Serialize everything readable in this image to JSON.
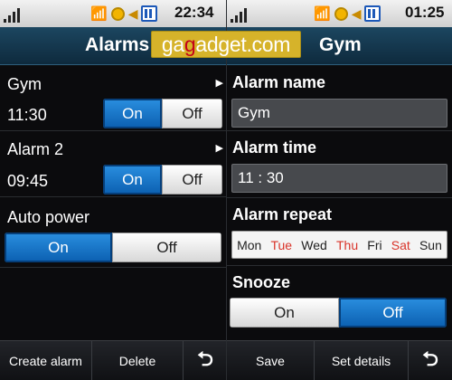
{
  "left": {
    "status": {
      "time": "22:34"
    },
    "title": "Alarms",
    "alarms": [
      {
        "name": "Gym",
        "time": "11:30",
        "on_label": "On",
        "off_label": "Off",
        "state": "on"
      },
      {
        "name": "Alarm 2",
        "time": "09:45",
        "on_label": "On",
        "off_label": "Off",
        "state": "on"
      }
    ],
    "auto_power": {
      "label": "Auto power",
      "on_label": "On",
      "off_label": "Off",
      "state": "on"
    },
    "softkeys": {
      "create": "Create alarm",
      "delete": "Delete"
    }
  },
  "right": {
    "status": {
      "time": "01:25"
    },
    "title": "Gym",
    "alarm_name": {
      "label": "Alarm name",
      "value": "Gym"
    },
    "alarm_time": {
      "label": "Alarm time",
      "value": "11 : 30"
    },
    "alarm_repeat": {
      "label": "Alarm repeat",
      "days": [
        {
          "label": "Mon",
          "selected": false
        },
        {
          "label": "Tue",
          "selected": true
        },
        {
          "label": "Wed",
          "selected": false
        },
        {
          "label": "Thu",
          "selected": true
        },
        {
          "label": "Fri",
          "selected": false
        },
        {
          "label": "Sat",
          "selected": true
        },
        {
          "label": "Sun",
          "selected": false
        }
      ]
    },
    "snooze": {
      "label": "Snooze",
      "on_label": "On",
      "off_label": "Off",
      "state": "off"
    },
    "softkeys": {
      "save": "Save",
      "details": "Set details"
    }
  },
  "watermark": {
    "text_prefix": "ga",
    "text_highlight": "g",
    "text_rest": "adget.com"
  },
  "colors": {
    "accent_blue": "#0b5fb0",
    "weekend_red": "#d9342a",
    "title_bar": "#1c4660"
  },
  "icons": [
    "signal-icon",
    "wifi-icon",
    "alarm-clock-icon",
    "speaker-icon",
    "battery-icon",
    "back-arrow-icon",
    "chevron-right-icon"
  ]
}
